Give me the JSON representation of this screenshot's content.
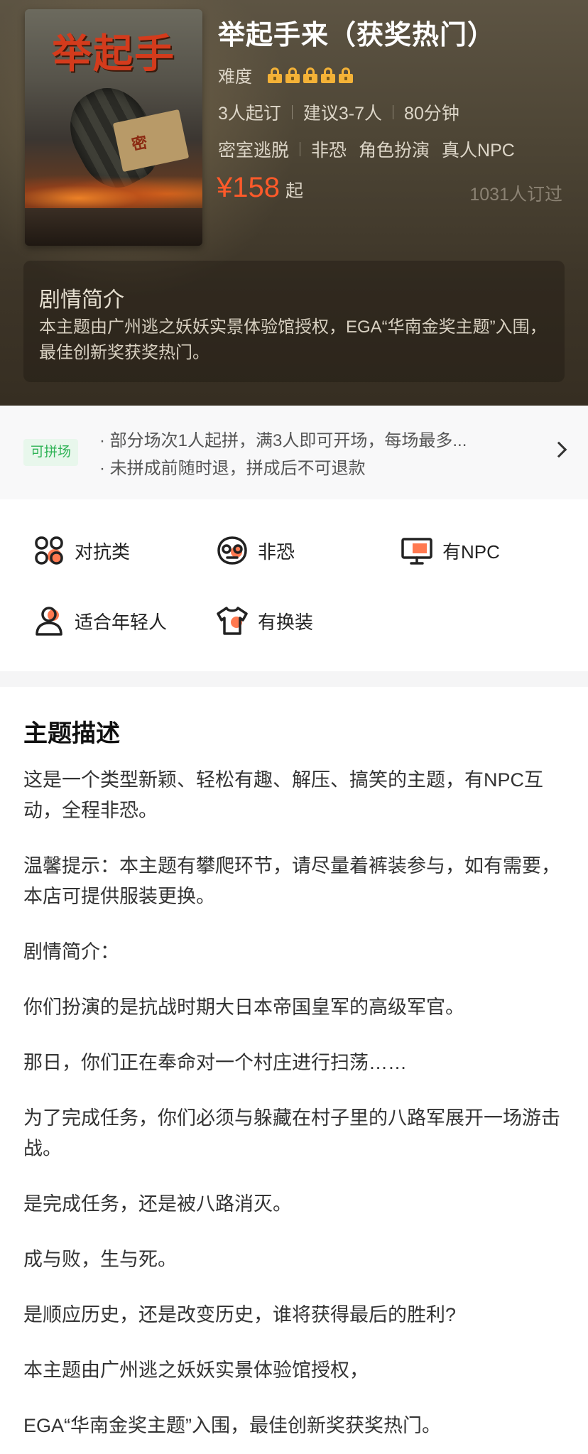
{
  "theme": {
    "title": "举起手来（获奖热门）",
    "poster_title": "举起手来",
    "poster_stamp": "密",
    "difficulty_label": "难度",
    "difficulty_level": 5,
    "difficulty_max": 5,
    "meta": [
      "3人起订",
      "建议3-7人",
      "80分钟"
    ],
    "tags": [
      "密室逃脱",
      "非恐",
      "角色扮演",
      "真人NPC"
    ],
    "price": "¥158",
    "price_suffix": "起",
    "booked": "1031人订过",
    "colors": {
      "price": "#ff5a2a",
      "lock": "#f4b237",
      "accent_icon": "#ff6a3d"
    }
  },
  "plot": {
    "title": "剧情简介",
    "text": "本主题由广州逃之妖妖实景体验馆授权，EGA“华南金奖主题”入围，最佳创新奖获奖热门。"
  },
  "share": {
    "badge": "可拼场",
    "lines": [
      "· 部分场次1人起拼，满3人即可开场，每场最多...",
      "· 未拼成前随时退，拼成后不可退款"
    ]
  },
  "features": [
    {
      "label": "对抗类",
      "icon": "clover-icon"
    },
    {
      "label": "非恐",
      "icon": "mask-icon"
    },
    {
      "label": "有NPC",
      "icon": "monitor-icon"
    },
    {
      "label": "适合年轻人",
      "icon": "person-icon"
    },
    {
      "label": "有换装",
      "icon": "shirt-icon"
    }
  ],
  "description": {
    "title": "主题描述",
    "paragraphs": [
      "这是一个类型新颖、轻松有趣、解压、搞笑的主题，有NPC互动，全程非恐。",
      "温馨提示：本主题有攀爬环节，请尽量着裤装参与，如有需要，本店可提供服装更换。",
      "剧情简介：",
      "你们扮演的是抗战时期大日本帝国皇军的高级军官。",
      "那日，你们正在奉命对一个村庄进行扫荡……",
      "为了完成任务，你们必须与躲藏在村子里的八路军展开一场游击战。",
      "是完成任务，还是被八路消灭。",
      "成与败，生与死。",
      "是顺应历史，还是改变历史，谁将获得最后的胜利?",
      "本主题由广州逃之妖妖实景体验馆授权，",
      "EGA“华南金奖主题”入围，最佳创新奖获奖热门。"
    ]
  }
}
